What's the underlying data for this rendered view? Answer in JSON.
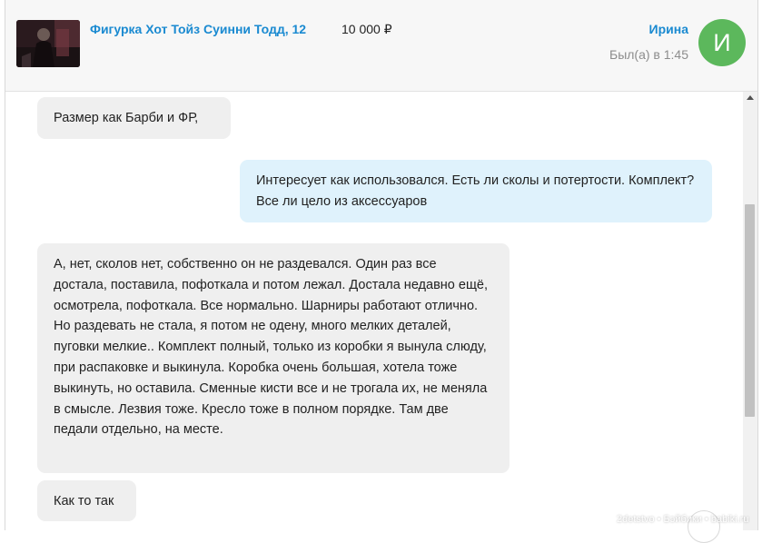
{
  "header": {
    "item_title": "Фигурка Хот Тойз Суинни Тодд, 12",
    "item_price": "10 000 ₽",
    "user_name": "Ирина",
    "user_status": "Был(а) в 1:45",
    "avatar_letter": "И",
    "avatar_color": "#5cb85c",
    "link_color": "#1a8ad1"
  },
  "messages": [
    {
      "direction": "incoming",
      "text": "Размер как Барби и ФР,"
    },
    {
      "direction": "outgoing",
      "text": "Интересует как использовался. Есть ли сколы и потертости. Комплект? Все ли цело из аксессуаров"
    },
    {
      "direction": "incoming",
      "text": "А, нет, сколов нет, собственно он не раздевался. Один раз все достала, поставила, пофоткала и потом лежал. Достала недавно ещё, осмотрела, пофоткала. Все нормально. Шарниры работают отлично. Но раздевать не стала, я потом не одену, много мелких деталей, пуговки мелкие.. Комплект полный, только из коробки я вынула слюду, при распаковке и выкинула. Коробка очень большая, хотела тоже выкинуть, но оставила. Сменные кисти все и не трогала их, не меняла в смысле. Лезвия тоже. Кресло тоже в полном порядке. Там две педали отдельно, на месте."
    },
    {
      "direction": "incoming",
      "text": "Как то так"
    }
  ],
  "watermark": "2detstvo • Бэйбики • babiki.ru"
}
